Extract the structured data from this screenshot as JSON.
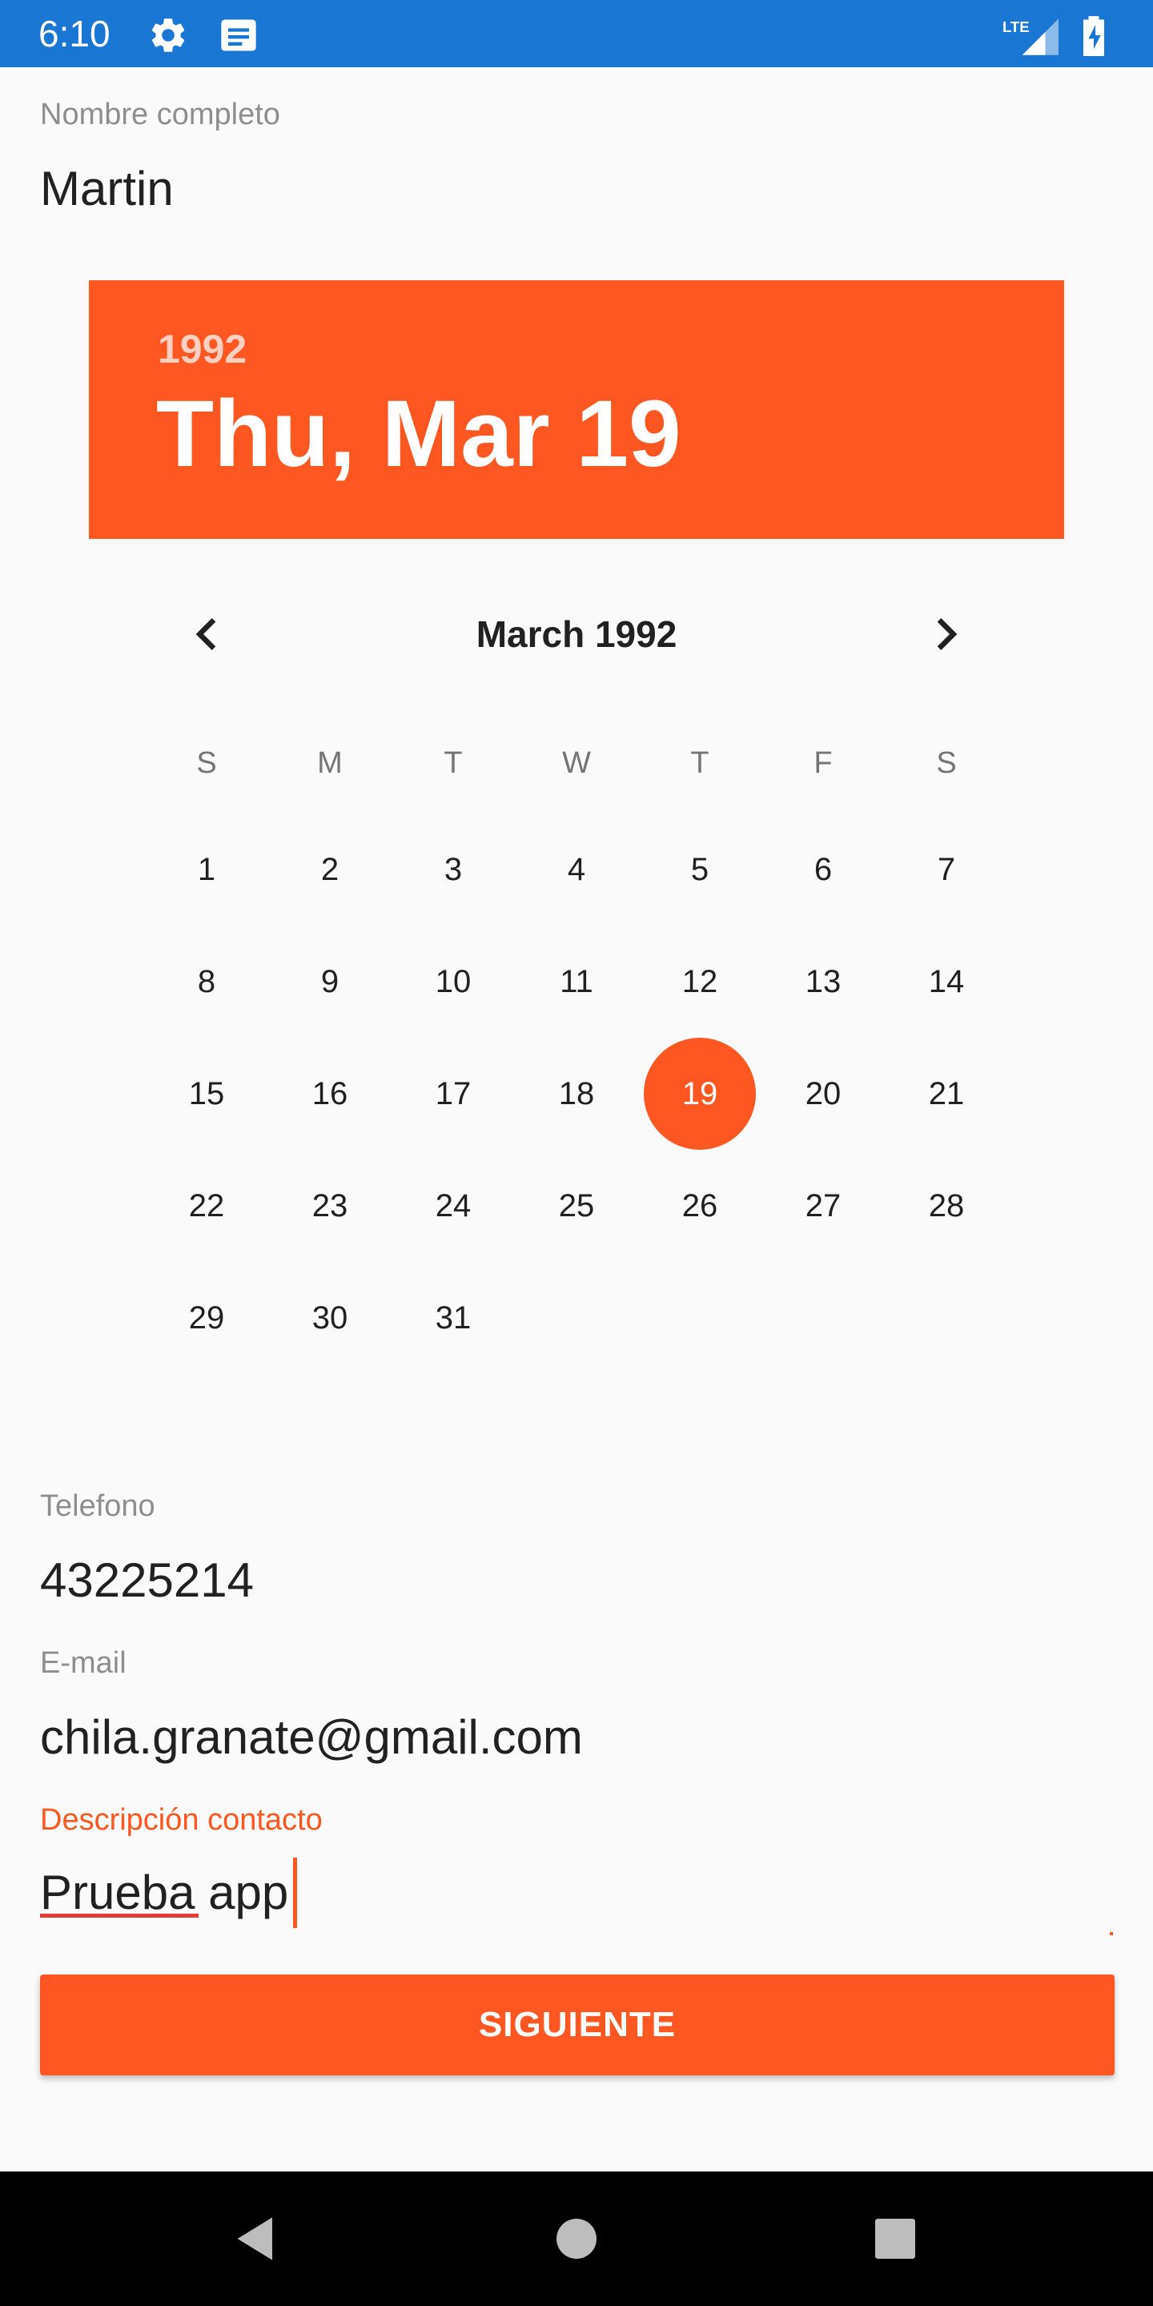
{
  "status_bar": {
    "time": "6:10",
    "network": "LTE",
    "icons": [
      "settings-icon",
      "notification-message-icon",
      "lte-signal-icon",
      "battery-charging-icon"
    ],
    "background_color": "#1976d2"
  },
  "form": {
    "name_label": "Nombre completo",
    "name_value": "Martin",
    "phone_label": "Telefono",
    "phone_value": "43225214",
    "email_label": "E-mail",
    "email_value": "chila.granate@gmail.com",
    "description_label": "Descripción contacto",
    "description_value": "Prueba app",
    "submit_label": "SIGUIENTE"
  },
  "date_picker": {
    "year": "1992",
    "selected_date": "Thu, Mar 19",
    "month_title": "March 1992",
    "prev_icon": "chevron-left-icon",
    "next_icon": "chevron-right-icon",
    "weekdays": [
      "S",
      "M",
      "T",
      "W",
      "T",
      "F",
      "S"
    ],
    "days": [
      "1",
      "2",
      "3",
      "4",
      "5",
      "6",
      "7",
      "8",
      "9",
      "10",
      "11",
      "12",
      "13",
      "14",
      "15",
      "16",
      "17",
      "18",
      "19",
      "20",
      "21",
      "22",
      "23",
      "24",
      "25",
      "26",
      "27",
      "28",
      "29",
      "30",
      "31"
    ],
    "first_weekday_index": 0,
    "selected_day": "19",
    "accent_color": "#ff5722"
  },
  "navigation_bar": {
    "icons": [
      "back-icon",
      "home-icon",
      "recents-icon"
    ]
  }
}
